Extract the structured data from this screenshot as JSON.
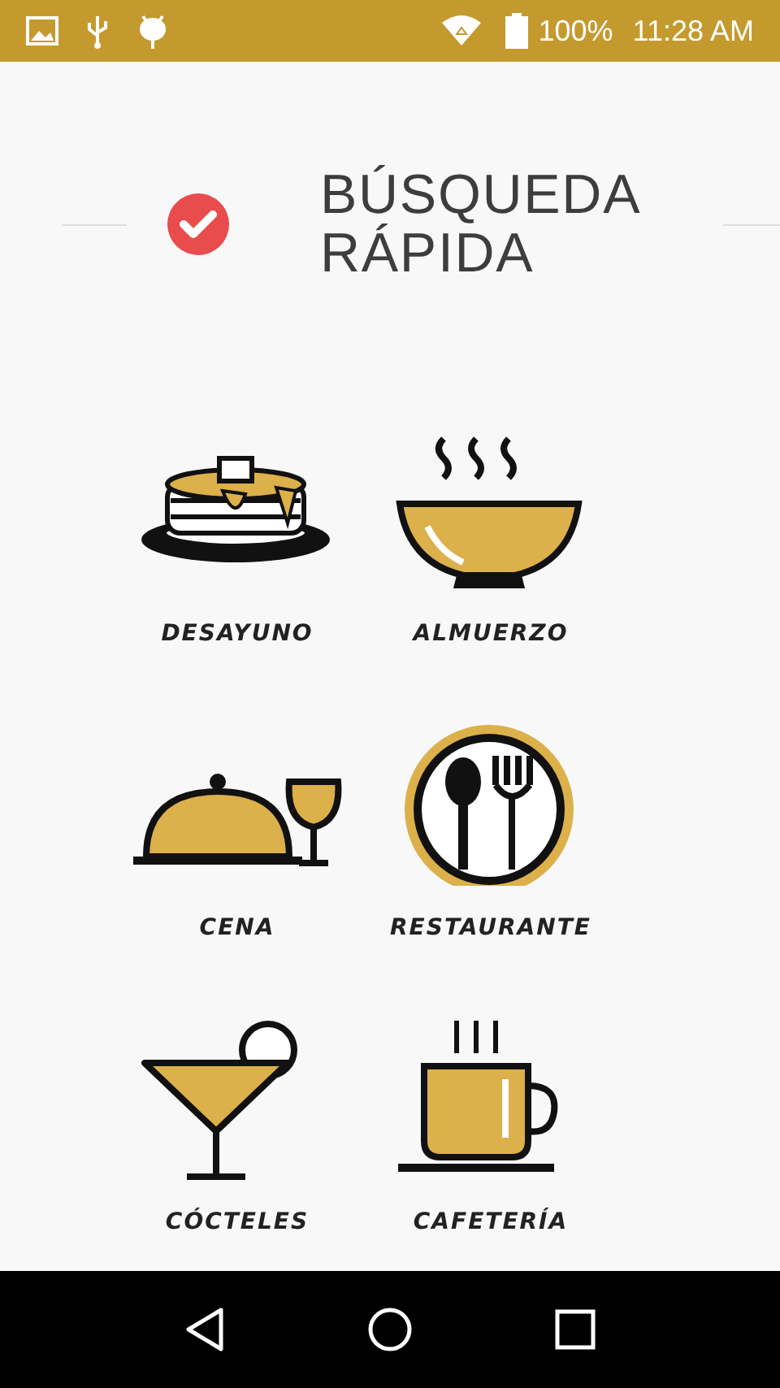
{
  "status_bar": {
    "battery": "100%",
    "time": "11:28 AM"
  },
  "header": {
    "title_lines": [
      "BÚSQUEDA",
      "RÁPIDA"
    ]
  },
  "categories": [
    {
      "kind": "pancakes",
      "label": "DESAYUNO"
    },
    {
      "kind": "soup",
      "label": "ALMUERZO"
    },
    {
      "kind": "cloche",
      "label": "CENA"
    },
    {
      "kind": "plate",
      "label": "RESTAURANTE"
    },
    {
      "kind": "cocktail",
      "label": "CÓCTELES"
    },
    {
      "kind": "coffee",
      "label": "CAFETERÍA"
    }
  ]
}
